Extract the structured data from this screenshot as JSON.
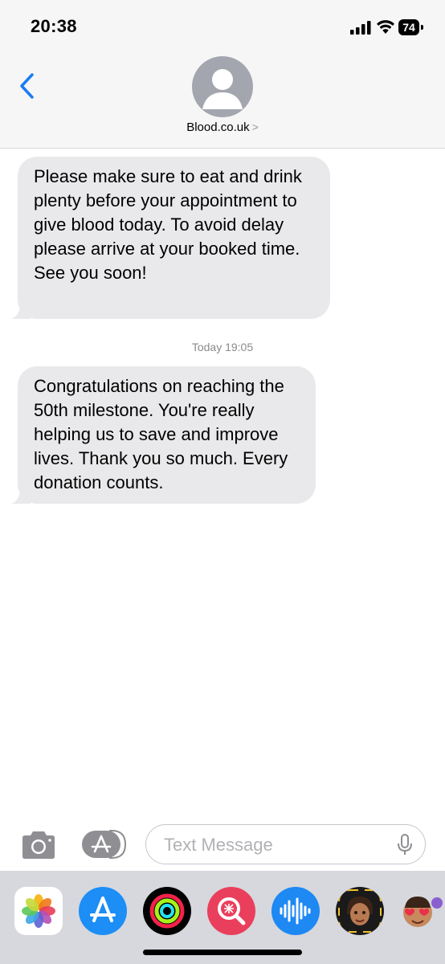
{
  "status_bar": {
    "time": "20:38",
    "battery": "74"
  },
  "header": {
    "contact_name": "Blood.co.uk",
    "contact_chevron": ">"
  },
  "messages": [
    {
      "text": "Please make sure to eat and drink plenty before your appointment to give blood today. To avoid delay please arrive at your booked time. See you soon!"
    },
    {
      "text": "Congratulations on reaching the 50th milestone. You're really helping us to save and improve lives. Thank you so much. Every donation counts."
    }
  ],
  "timestamp": {
    "day": "Today",
    "time": "19:05"
  },
  "compose": {
    "placeholder": "Text Message"
  },
  "app_drawer": [
    "photos-icon",
    "app-store-icon",
    "fitness-icon",
    "search-web-icon",
    "audio-message-icon",
    "memoji-icon",
    "memoji-stickers-icon"
  ]
}
